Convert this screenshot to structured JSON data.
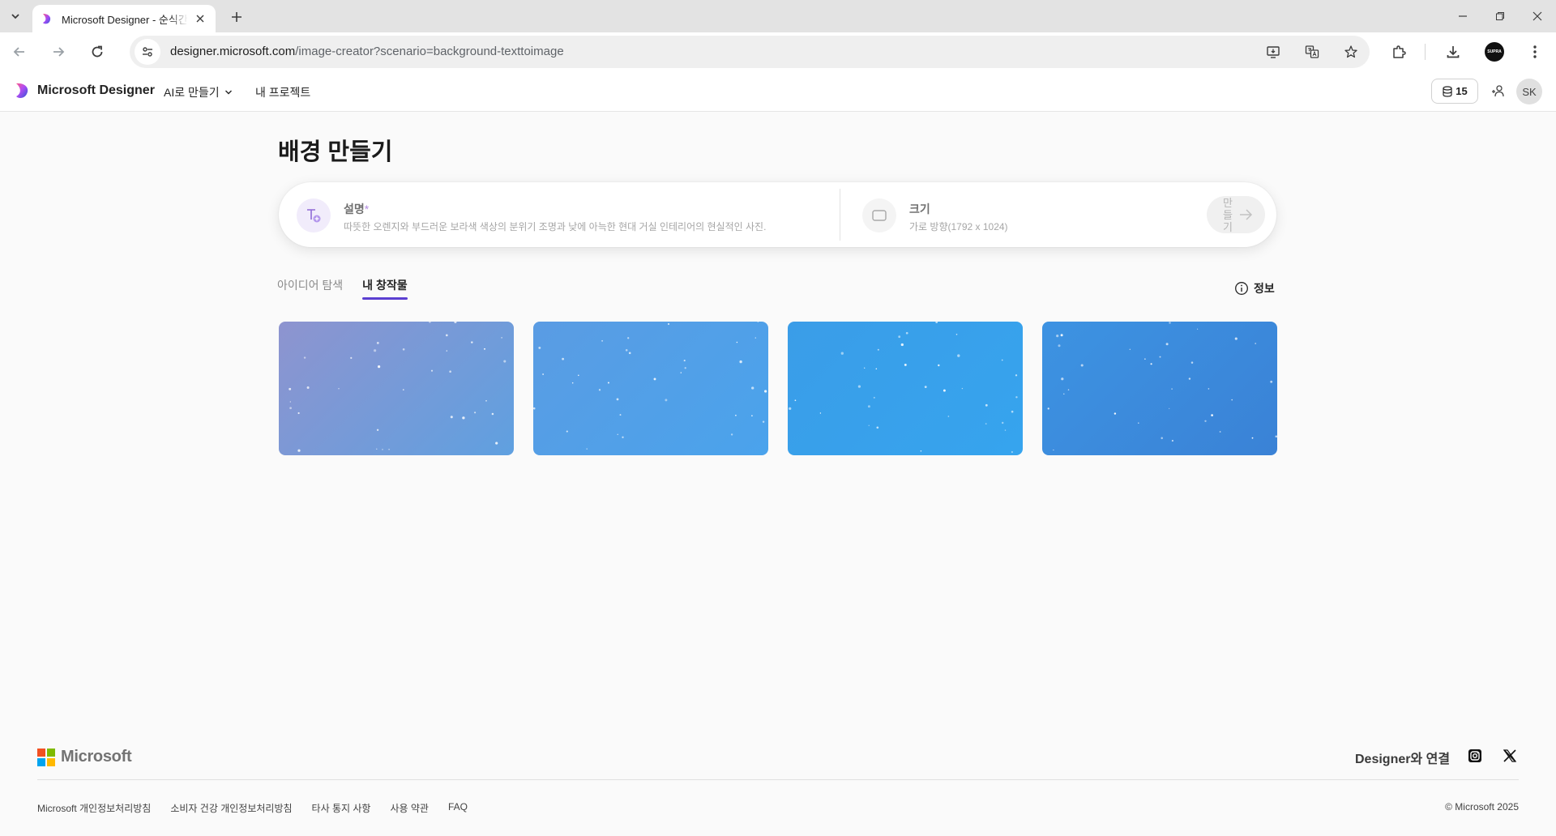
{
  "browser": {
    "tab_title": "Microsoft Designer - 순식간",
    "url_host": "designer.microsoft.com",
    "url_path": "/image-creator?scenario=background-texttoimage",
    "profile_label": "SUPRA"
  },
  "header": {
    "brand": "Microsoft Designer",
    "nav_ai": "AI로 만들기",
    "nav_projects": "내 프로젝트",
    "credits": "15",
    "avatar": "SK"
  },
  "main": {
    "title": "배경 만들기",
    "prompt": {
      "description_label": "설명",
      "required_mark": "*",
      "description_value": "따뜻한 오렌지와 부드러운 보라색 색상의 분위기 조명과 낮에 아늑한 현대 거실 인테리어의 현실적인 사진.",
      "size_label": "크기",
      "size_value": "가로 방향(1792 x 1024)",
      "create_label": "만들기"
    },
    "tabs": [
      "아이디어 탐색",
      "내 창작물"
    ],
    "active_tab": 1,
    "info": "정보",
    "gallery": [
      {
        "from": "#8e94cf",
        "to": "#5fa0e0"
      },
      {
        "from": "#5a9ce3",
        "to": "#4aa3ec"
      },
      {
        "from": "#3a9de8",
        "to": "#36a4ee"
      },
      {
        "from": "#3d93e2",
        "to": "#3a82d6"
      }
    ]
  },
  "footer": {
    "brand": "Microsoft",
    "connect": "Designer와 연결",
    "links": [
      "Microsoft 개인정보처리방침",
      "소비자 건강 개인정보처리방침",
      "타사 통지 사항",
      "사용 약관",
      "FAQ"
    ],
    "copyright": "© Microsoft 2025"
  },
  "colors": {
    "accent": "#5b3fd1",
    "ms_red": "#f25022",
    "ms_green": "#7fba00",
    "ms_blue": "#00a4ef",
    "ms_yellow": "#ffb900"
  }
}
